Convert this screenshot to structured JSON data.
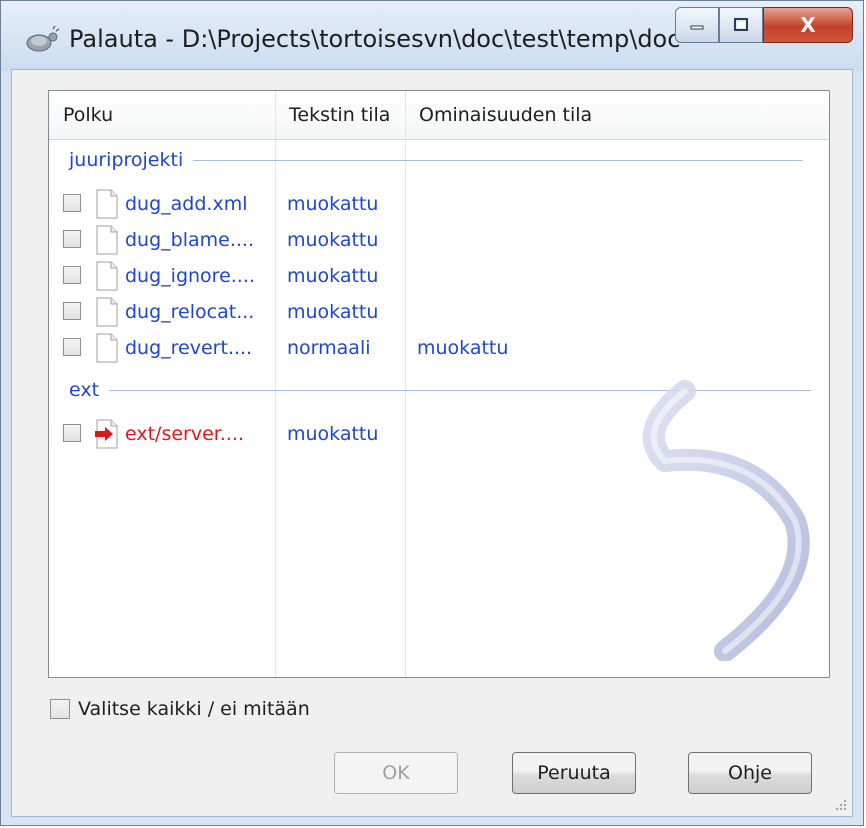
{
  "window": {
    "title": "Palauta - D:\\Projects\\tortoisesvn\\doc\\test\\temp\\doc",
    "close_glyph": "X"
  },
  "list": {
    "columns": [
      "Polku",
      "Tekstin tila",
      "Ominaisuuden tila"
    ],
    "groups": [
      {
        "name": "juuriprojekti",
        "rows": [
          {
            "path": "dug_add.xml",
            "text_status": "muokattu",
            "prop_status": "",
            "icon": "file-icon",
            "color": "blue"
          },
          {
            "path": "dug_blame....",
            "text_status": "muokattu",
            "prop_status": "",
            "icon": "file-icon",
            "color": "blue"
          },
          {
            "path": "dug_ignore....",
            "text_status": "muokattu",
            "prop_status": "",
            "icon": "file-icon",
            "color": "blue"
          },
          {
            "path": "dug_relocat...",
            "text_status": "muokattu",
            "prop_status": "",
            "icon": "file-icon",
            "color": "blue"
          },
          {
            "path": "dug_revert....",
            "text_status": "normaali",
            "prop_status": "muokattu",
            "icon": "file-icon",
            "color": "blue"
          }
        ]
      },
      {
        "name": "ext",
        "rows": [
          {
            "path": "ext/server....",
            "text_status": "muokattu",
            "prop_status": "",
            "icon": "external-file-icon",
            "color": "red"
          }
        ]
      }
    ]
  },
  "select_all_label": "Valitse kaikki / ei mitään",
  "buttons": {
    "ok": "OK",
    "cancel": "Peruuta",
    "help": "Ohje"
  },
  "colors": {
    "link_blue": "#1e46d2",
    "external_red": "#e4161b"
  }
}
